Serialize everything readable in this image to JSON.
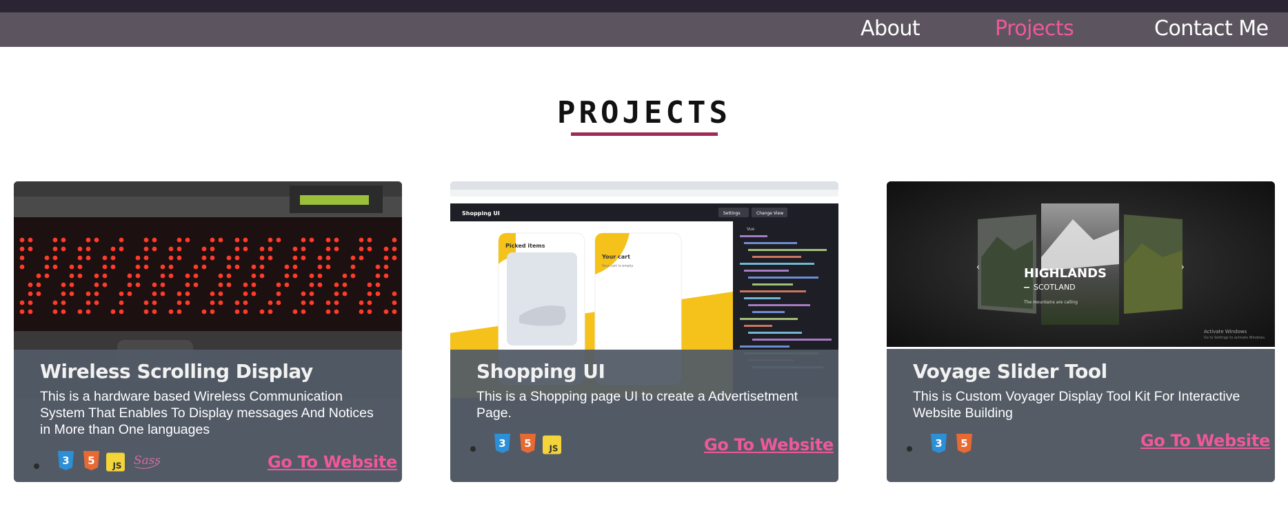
{
  "nav": {
    "links": [
      {
        "label": "About",
        "active": false
      },
      {
        "label": "Projects",
        "active": true
      },
      {
        "label": "Contact Me",
        "active": false
      }
    ]
  },
  "section": {
    "title": "PROJECTS"
  },
  "projects": [
    {
      "title": "Wireless Scrolling Display",
      "description": "This is a hardware based Wireless Communication System That Enables To Display messages And Notices in More than One languages",
      "tech_icons": [
        "css3-icon",
        "html5-icon",
        "javascript-icon",
        "sass-icon"
      ],
      "link_label": "Go To Website"
    },
    {
      "title": "Shopping UI",
      "description": "This is a Shopping page UI to create a Advertisetment Page.",
      "tech_icons": [
        "css3-icon",
        "html5-icon",
        "javascript-icon"
      ],
      "link_label": "Go To Website",
      "screenshot": {
        "brand": "Shopping UI",
        "picked_label": "Picked items",
        "cart_label": "Your cart",
        "cart_empty": "Your cart is empty",
        "settings_label": "Settings",
        "change_view_label": "Change View",
        "panel_label": "Vue"
      }
    },
    {
      "title": "Voyage Slider Tool",
      "description": "This is Custom Voyager Display Tool Kit For Interactive Website Building",
      "tech_icons": [
        "css3-icon",
        "html5-icon"
      ],
      "link_label": "Go To Website",
      "screenshot": {
        "heading": "HIGHLANDS",
        "subheading": "SCOTLAND",
        "tagline": "The mountains are calling",
        "watermark_line1": "Activate Windows",
        "watermark_line2": "Go to Settings to activate Windows."
      }
    }
  ],
  "colors": {
    "accent": "#f0589a",
    "underline": "#9e2a57",
    "card": "#555c66"
  }
}
